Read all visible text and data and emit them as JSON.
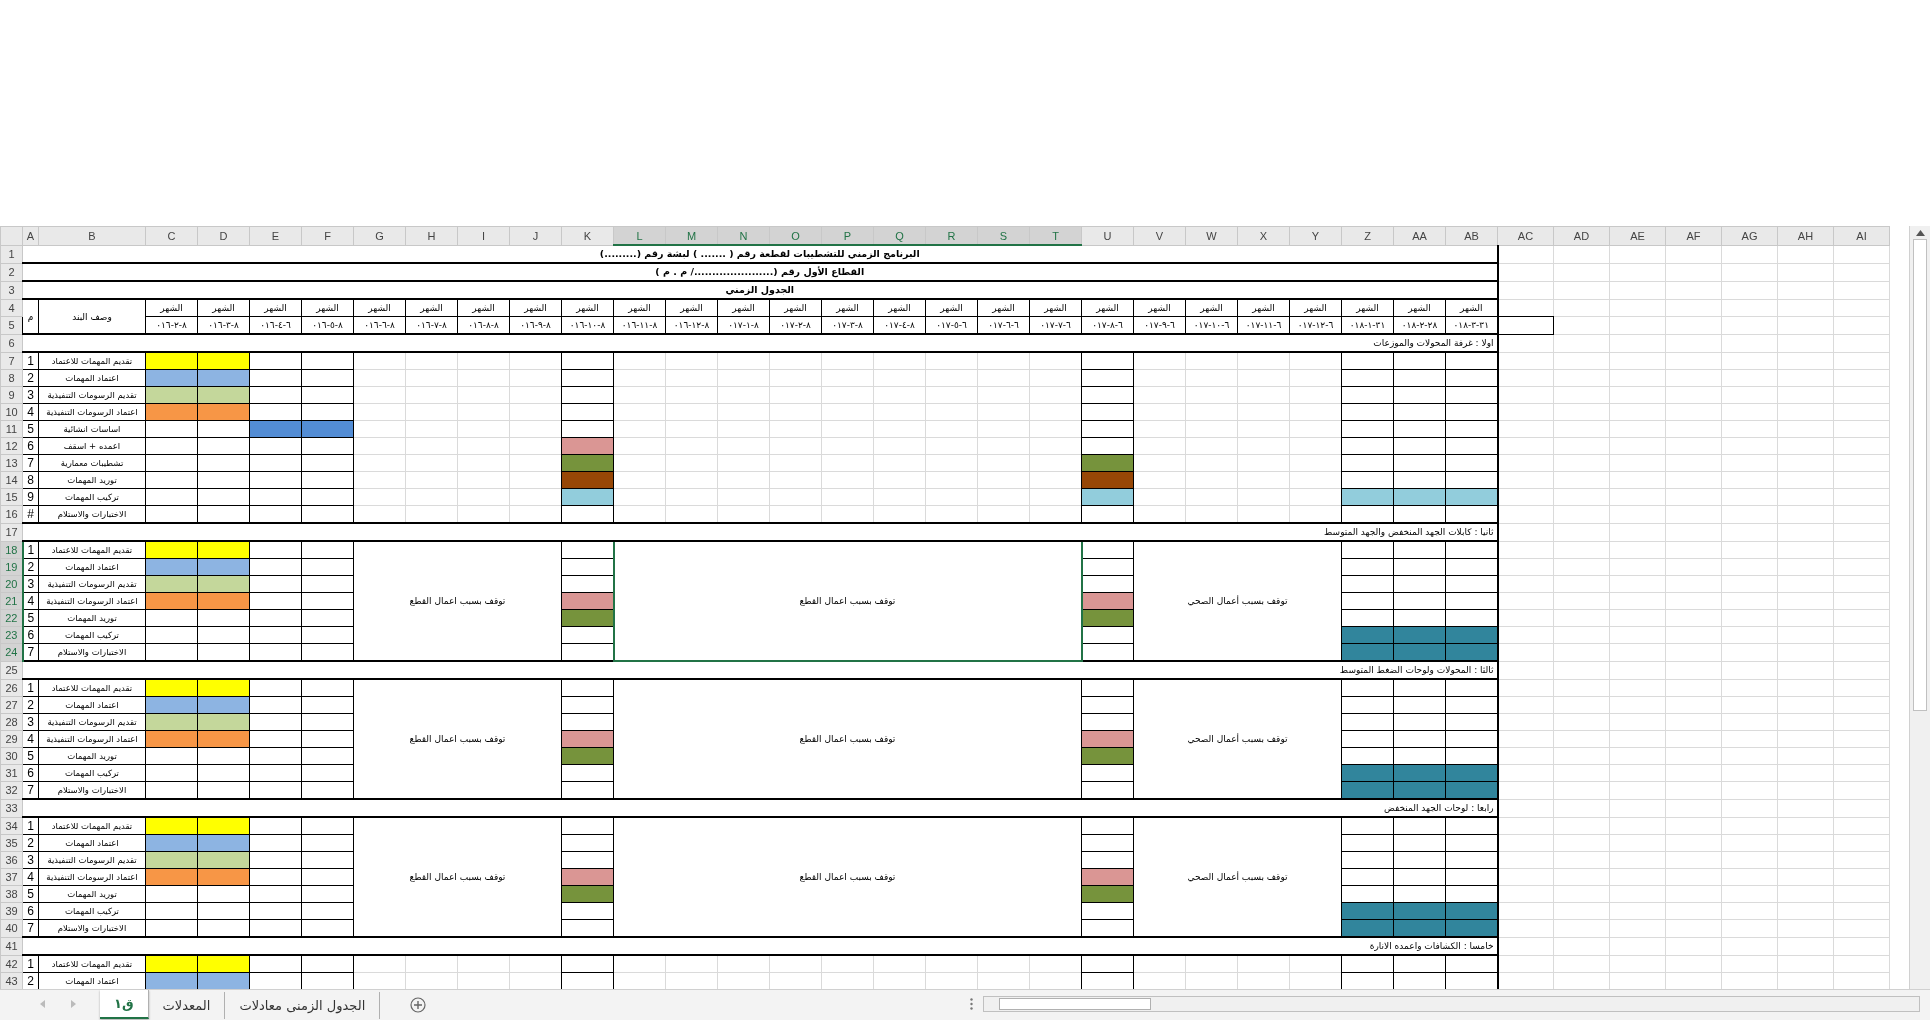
{
  "columns": [
    {
      "letter": "AI",
      "selected": false
    },
    {
      "letter": "AH",
      "selected": false
    },
    {
      "letter": "AG",
      "selected": false
    },
    {
      "letter": "AF",
      "selected": false
    },
    {
      "letter": "AE",
      "selected": false
    },
    {
      "letter": "AD",
      "selected": false
    },
    {
      "letter": "AC",
      "selected": false
    },
    {
      "letter": "AB",
      "selected": false
    },
    {
      "letter": "AA",
      "selected": false
    },
    {
      "letter": "Z",
      "selected": false
    },
    {
      "letter": "Y",
      "selected": false
    },
    {
      "letter": "X",
      "selected": false
    },
    {
      "letter": "W",
      "selected": false
    },
    {
      "letter": "V",
      "selected": false
    },
    {
      "letter": "U",
      "selected": false
    },
    {
      "letter": "T",
      "selected": true
    },
    {
      "letter": "S",
      "selected": true
    },
    {
      "letter": "R",
      "selected": true
    },
    {
      "letter": "Q",
      "selected": true
    },
    {
      "letter": "P",
      "selected": true
    },
    {
      "letter": "O",
      "selected": true
    },
    {
      "letter": "N",
      "selected": true
    },
    {
      "letter": "M",
      "selected": true
    },
    {
      "letter": "L",
      "selected": true
    },
    {
      "letter": "K",
      "selected": false
    },
    {
      "letter": "J",
      "selected": false
    },
    {
      "letter": "I",
      "selected": false
    },
    {
      "letter": "H",
      "selected": false
    },
    {
      "letter": "G",
      "selected": false
    },
    {
      "letter": "F",
      "selected": false
    },
    {
      "letter": "E",
      "selected": false
    },
    {
      "letter": "D",
      "selected": false
    },
    {
      "letter": "C",
      "selected": false
    },
    {
      "letter": "B",
      "selected": false
    },
    {
      "letter": "A",
      "selected": false
    }
  ],
  "row_headers": [
    {
      "number": "1",
      "selected": false
    },
    {
      "number": "2",
      "selected": false
    },
    {
      "number": "3",
      "selected": false
    },
    {
      "number": "4",
      "selected": false
    },
    {
      "number": "5",
      "selected": false
    },
    {
      "number": "6",
      "selected": false
    },
    {
      "number": "7",
      "selected": false
    },
    {
      "number": "8",
      "selected": false
    },
    {
      "number": "9",
      "selected": false
    },
    {
      "number": "10",
      "selected": false
    },
    {
      "number": "11",
      "selected": false
    },
    {
      "number": "12",
      "selected": false
    },
    {
      "number": "13",
      "selected": false
    },
    {
      "number": "14",
      "selected": false
    },
    {
      "number": "15",
      "selected": false
    },
    {
      "number": "16",
      "selected": false
    },
    {
      "number": "17",
      "selected": false
    },
    {
      "number": "18",
      "selected": true
    },
    {
      "number": "19",
      "selected": true
    },
    {
      "number": "20",
      "selected": true
    },
    {
      "number": "21",
      "selected": true
    },
    {
      "number": "22",
      "selected": true
    },
    {
      "number": "23",
      "selected": true
    },
    {
      "number": "24",
      "selected": true
    },
    {
      "number": "25",
      "selected": false
    },
    {
      "number": "26",
      "selected": false
    },
    {
      "number": "27",
      "selected": false
    },
    {
      "number": "28",
      "selected": false
    },
    {
      "number": "29",
      "selected": false
    },
    {
      "number": "30",
      "selected": false
    },
    {
      "number": "31",
      "selected": false
    },
    {
      "number": "32",
      "selected": false
    },
    {
      "number": "33",
      "selected": false
    },
    {
      "number": "34",
      "selected": false
    },
    {
      "number": "35",
      "selected": false
    },
    {
      "number": "36",
      "selected": false
    },
    {
      "number": "37",
      "selected": false
    },
    {
      "number": "38",
      "selected": false
    },
    {
      "number": "39",
      "selected": false
    },
    {
      "number": "40",
      "selected": false
    },
    {
      "number": "41",
      "selected": false
    },
    {
      "number": "42",
      "selected": false
    },
    {
      "number": "43",
      "selected": false
    }
  ],
  "titles": [
    "البرنامج الزمني للتشطيبات لقطعة رقم ( ....... ) لبشة رقم (.........)",
    "القطاع الأول رقم (....................../ م . م )",
    "الجدول الزمني"
  ],
  "header": {
    "number_label": "م",
    "description_label": "وصف البند",
    "months": [
      {
        "label": "الشهر",
        "date": "٠١٨-٣-٣١"
      },
      {
        "label": "الشهر",
        "date": "٠١٨-٢-٢٨"
      },
      {
        "label": "الشهر",
        "date": "٠١٨-١-٣١"
      },
      {
        "label": "الشهر",
        "date": "٠١٧-١٢-٦"
      },
      {
        "label": "الشهر",
        "date": "٠١٧-١١-٦"
      },
      {
        "label": "الشهر",
        "date": "٠١٧-١٠-٦"
      },
      {
        "label": "الشهر",
        "date": "٠١٧-٩-٦"
      },
      {
        "label": "الشهر",
        "date": "٠١٧-٨-٦"
      },
      {
        "label": "الشهر",
        "date": "٠١٧-٧-٦"
      },
      {
        "label": "الشهر",
        "date": "٠١٧-٦-٦"
      },
      {
        "label": "الشهر",
        "date": "٠١٧-٥-٦"
      },
      {
        "label": "الشهر",
        "date": "٠١٧-٤-٨"
      },
      {
        "label": "الشهر",
        "date": "٠١٧-٣-٨"
      },
      {
        "label": "الشهر",
        "date": "٠١٧-٢-٨"
      },
      {
        "label": "الشهر",
        "date": "٠١٧-١-٨"
      },
      {
        "label": "الشهر",
        "date": "٠١٦-١٢-٨"
      },
      {
        "label": "الشهر",
        "date": "٠١٦-١١-٨"
      },
      {
        "label": "الشهر",
        "date": "٠١٦-١٠-٨"
      },
      {
        "label": "الشهر",
        "date": "٠١٦-٩-٨"
      },
      {
        "label": "الشهر",
        "date": "٠١٦-٨-٨"
      },
      {
        "label": "الشهر",
        "date": "٠١٦-٧-٨"
      },
      {
        "label": "الشهر",
        "date": "٠١٦-٦-٨"
      },
      {
        "label": "الشهر",
        "date": "٠١٦-٥-٨"
      },
      {
        "label": "الشهر",
        "date": "٠١٦-٤-٦"
      },
      {
        "label": "الشهر",
        "date": "٠١٦-٣-٨"
      },
      {
        "label": "الشهر",
        "date": "٠١٦-٢-٨"
      }
    ]
  },
  "sections": [
    {
      "title": "اولا : غرفة المحولات والموزعات",
      "items": [
        {
          "number": "1",
          "description": "تقديم المهمات للاعتماد",
          "cells": [
            {
              "kind": "blank"
            },
            {
              "kind": "blank"
            },
            {
              "kind": "blank"
            },
            {
              "kind": "blank"
            },
            {
              "kind": "blank"
            },
            {
              "kind": "blank"
            },
            {
              "kind": "blank"
            },
            {
              "kind": "bar",
              "color": "#ffff00"
            },
            {
              "kind": "bar",
              "color": "#ffff00"
            }
          ]
        },
        {
          "number": "2",
          "description": "اعتماد المهمات",
          "cells": [
            {
              "kind": "blank"
            },
            {
              "kind": "blank"
            },
            {
              "kind": "blank"
            },
            {
              "kind": "blank"
            },
            {
              "kind": "blank"
            },
            {
              "kind": "blank"
            },
            {
              "kind": "blank"
            },
            {
              "kind": "bar",
              "color": "#8db4e2"
            },
            {
              "kind": "bar",
              "color": "#8db4e2"
            }
          ]
        },
        {
          "number": "3",
          "description": "تقديم الرسومات التنفيذية",
          "cells": [
            {
              "kind": "blank"
            },
            {
              "kind": "blank"
            },
            {
              "kind": "blank"
            },
            {
              "kind": "blank"
            },
            {
              "kind": "blank"
            },
            {
              "kind": "blank"
            },
            {
              "kind": "blank"
            },
            {
              "kind": "bar",
              "color": "#c4d79b"
            },
            {
              "kind": "bar",
              "color": "#c4d79b"
            }
          ]
        },
        {
          "number": "4",
          "description": "اعتماد الرسومات التنفيذية",
          "cells": [
            {
              "kind": "blank"
            },
            {
              "kind": "blank"
            },
            {
              "kind": "blank"
            },
            {
              "kind": "blank"
            },
            {
              "kind": "blank"
            },
            {
              "kind": "blank"
            },
            {
              "kind": "blank"
            },
            {
              "kind": "bar",
              "color": "#f79646"
            },
            {
              "kind": "bar",
              "color": "#f79646"
            }
          ]
        },
        {
          "number": "5",
          "description": "اساسات انشائية",
          "cells": [
            {
              "kind": "blank"
            },
            {
              "kind": "blank"
            },
            {
              "kind": "blank"
            },
            {
              "kind": "blank"
            },
            {
              "kind": "blank"
            },
            {
              "kind": "bar",
              "color": "#538dd5"
            },
            {
              "kind": "bar",
              "color": "#538dd5"
            },
            {
              "kind": "blank"
            },
            {
              "kind": "blank"
            }
          ]
        },
        {
          "number": "6",
          "description": "اعمده + اسقف",
          "cells": [
            {
              "kind": "blank"
            },
            {
              "kind": "blank"
            },
            {
              "kind": "blank"
            },
            {
              "kind": "blank"
            },
            {
              "kind": "bar",
              "color": "#da9694"
            },
            {
              "kind": "blank"
            },
            {
              "kind": "blank"
            },
            {
              "kind": "blank"
            },
            {
              "kind": "blank"
            }
          ]
        },
        {
          "number": "7",
          "description": "تشطيبات معمارية",
          "cells": [
            {
              "kind": "blank"
            },
            {
              "kind": "blank"
            },
            {
              "kind": "blank"
            },
            {
              "kind": "bar",
              "color": "#76933c"
            },
            {
              "kind": "bar",
              "color": "#76933c"
            },
            {
              "kind": "blank"
            },
            {
              "kind": "blank"
            },
            {
              "kind": "blank"
            },
            {
              "kind": "blank"
            }
          ]
        },
        {
          "number": "8",
          "description": "توريد المهمات",
          "cells": [
            {
              "kind": "blank"
            },
            {
              "kind": "blank"
            },
            {
              "kind": "blank"
            },
            {
              "kind": "bar",
              "color": "#974706"
            },
            {
              "kind": "bar",
              "color": "#974706"
            },
            {
              "kind": "blank"
            },
            {
              "kind": "blank"
            },
            {
              "kind": "blank"
            },
            {
              "kind": "blank"
            }
          ]
        },
        {
          "number": "9",
          "description": "تركيب المهمات",
          "cells": [
            {
              "kind": "bar",
              "color": "#92cddc"
            },
            {
              "kind": "bar",
              "color": "#92cddc"
            },
            {
              "kind": "bar",
              "color": "#92cddc"
            },
            {
              "kind": "bar",
              "color": "#92cddc"
            },
            {
              "kind": "bar",
              "color": "#92cddc"
            },
            {
              "kind": "blank"
            },
            {
              "kind": "blank"
            },
            {
              "kind": "blank"
            },
            {
              "kind": "blank"
            }
          ]
        },
        {
          "number": "#",
          "description": "الاختبارات والاستلام",
          "cells": [
            {
              "kind": "blank"
            },
            {
              "kind": "blank"
            },
            {
              "kind": "blank"
            },
            {
              "kind": "blank"
            },
            {
              "kind": "blank"
            },
            {
              "kind": "blank"
            },
            {
              "kind": "blank"
            },
            {
              "kind": "blank"
            },
            {
              "kind": "blank"
            }
          ]
        }
      ]
    },
    {
      "title": "ثانيا : كابلات الجهد المنخفض والجهد المتوسط",
      "notes": [
        {
          "text": "توقف بسبب أعمال الصحي",
          "selected": false
        },
        {
          "text": "توقف بسبب اعمال القطع",
          "selected": true
        },
        {
          "text": "توقف بسبب اعمال القطع",
          "selected": false
        }
      ],
      "items": [
        {
          "number": "1",
          "description": "تقديم المهمات للاعتماد",
          "cells": [
            {
              "kind": "blank"
            },
            {
              "kind": "blank"
            },
            {
              "kind": "blank"
            },
            {
              "kind": "blank"
            },
            {
              "kind": "blank"
            },
            {
              "kind": "blank"
            },
            {
              "kind": "blank"
            },
            {
              "kind": "bar",
              "color": "#ffff00"
            },
            {
              "kind": "bar",
              "color": "#ffff00"
            }
          ]
        },
        {
          "number": "2",
          "description": "اعتماد المهمات",
          "cells": [
            {
              "kind": "blank"
            },
            {
              "kind": "blank"
            },
            {
              "kind": "blank"
            },
            {
              "kind": "blank"
            },
            {
              "kind": "blank"
            },
            {
              "kind": "blank"
            },
            {
              "kind": "blank"
            },
            {
              "kind": "bar",
              "color": "#8db4e2"
            },
            {
              "kind": "bar",
              "color": "#8db4e2"
            }
          ]
        },
        {
          "number": "3",
          "description": "تقديم الرسومات التنفيذية",
          "cells": [
            {
              "kind": "blank"
            },
            {
              "kind": "blank"
            },
            {
              "kind": "blank"
            },
            {
              "kind": "blank"
            },
            {
              "kind": "blank"
            },
            {
              "kind": "blank"
            },
            {
              "kind": "blank"
            },
            {
              "kind": "bar",
              "color": "#c4d79b"
            },
            {
              "kind": "bar",
              "color": "#c4d79b"
            }
          ]
        },
        {
          "number": "4",
          "description": "اعتماد الرسومات التنفيذية",
          "cells": [
            {
              "kind": "blank"
            },
            {
              "kind": "blank"
            },
            {
              "kind": "blank"
            },
            {
              "kind": "bar",
              "color": "#da9694"
            },
            {
              "kind": "bar",
              "color": "#da9694"
            },
            {
              "kind": "blank"
            },
            {
              "kind": "blank"
            },
            {
              "kind": "bar",
              "color": "#f79646"
            },
            {
              "kind": "bar",
              "color": "#f79646"
            }
          ]
        },
        {
          "number": "5",
          "description": "توريد المهمات",
          "cells": [
            {
              "kind": "blank"
            },
            {
              "kind": "blank"
            },
            {
              "kind": "blank"
            },
            {
              "kind": "bar",
              "color": "#76933c"
            },
            {
              "kind": "bar",
              "color": "#76933c"
            },
            {
              "kind": "blank"
            },
            {
              "kind": "blank"
            },
            {
              "kind": "blank"
            },
            {
              "kind": "blank"
            }
          ]
        },
        {
          "number": "6",
          "description": "تركيب المهمات",
          "cells": [
            {
              "kind": "bar",
              "color": "#31859c"
            },
            {
              "kind": "bar",
              "color": "#31859c"
            },
            {
              "kind": "bar",
              "color": "#31859c"
            },
            {
              "kind": "blank"
            },
            {
              "kind": "blank"
            },
            {
              "kind": "blank"
            },
            {
              "kind": "blank"
            },
            {
              "kind": "blank"
            },
            {
              "kind": "blank"
            }
          ]
        },
        {
          "number": "7",
          "description": "الاختبارات والاستلام",
          "cells": [
            {
              "kind": "bar",
              "color": "#31859c"
            },
            {
              "kind": "bar",
              "color": "#31859c"
            },
            {
              "kind": "bar",
              "color": "#31859c"
            },
            {
              "kind": "blank"
            },
            {
              "kind": "blank"
            },
            {
              "kind": "blank"
            },
            {
              "kind": "blank"
            },
            {
              "kind": "blank"
            },
            {
              "kind": "blank"
            }
          ]
        }
      ]
    },
    {
      "title": "ثالثا : المحولات ولوحات الضغط المتوسط",
      "notes": [
        {
          "text": "توقف بسبب أعمال الصحي",
          "selected": false
        },
        {
          "text": "توقف بسبب اعمال القطع",
          "selected": false
        },
        {
          "text": "توقف بسبب اعمال القطع",
          "selected": false
        }
      ],
      "items": [
        {
          "number": "1",
          "description": "تقديم المهمات للاعتماد",
          "cells": [
            {
              "kind": "blank"
            },
            {
              "kind": "blank"
            },
            {
              "kind": "blank"
            },
            {
              "kind": "blank"
            },
            {
              "kind": "blank"
            },
            {
              "kind": "blank"
            },
            {
              "kind": "blank"
            },
            {
              "kind": "bar",
              "color": "#ffff00"
            },
            {
              "kind": "bar",
              "color": "#ffff00"
            }
          ]
        },
        {
          "number": "2",
          "description": "اعتماد المهمات",
          "cells": [
            {
              "kind": "blank"
            },
            {
              "kind": "blank"
            },
            {
              "kind": "blank"
            },
            {
              "kind": "blank"
            },
            {
              "kind": "blank"
            },
            {
              "kind": "blank"
            },
            {
              "kind": "blank"
            },
            {
              "kind": "bar",
              "color": "#8db4e2"
            },
            {
              "kind": "bar",
              "color": "#8db4e2"
            }
          ]
        },
        {
          "number": "3",
          "description": "تقديم الرسومات التنفيذية",
          "cells": [
            {
              "kind": "blank"
            },
            {
              "kind": "blank"
            },
            {
              "kind": "blank"
            },
            {
              "kind": "blank"
            },
            {
              "kind": "blank"
            },
            {
              "kind": "blank"
            },
            {
              "kind": "blank"
            },
            {
              "kind": "bar",
              "color": "#c4d79b"
            },
            {
              "kind": "bar",
              "color": "#c4d79b"
            }
          ]
        },
        {
          "number": "4",
          "description": "اعتماد الرسومات التنفيذية",
          "cells": [
            {
              "kind": "blank"
            },
            {
              "kind": "blank"
            },
            {
              "kind": "blank"
            },
            {
              "kind": "bar",
              "color": "#da9694"
            },
            {
              "kind": "bar",
              "color": "#da9694"
            },
            {
              "kind": "blank"
            },
            {
              "kind": "blank"
            },
            {
              "kind": "bar",
              "color": "#f79646"
            },
            {
              "kind": "bar",
              "color": "#f79646"
            }
          ]
        },
        {
          "number": "5",
          "description": "توريد المهمات",
          "cells": [
            {
              "kind": "blank"
            },
            {
              "kind": "blank"
            },
            {
              "kind": "blank"
            },
            {
              "kind": "bar",
              "color": "#76933c"
            },
            {
              "kind": "bar",
              "color": "#76933c"
            },
            {
              "kind": "blank"
            },
            {
              "kind": "blank"
            },
            {
              "kind": "blank"
            },
            {
              "kind": "blank"
            }
          ]
        },
        {
          "number": "6",
          "description": "تركيب المهمات",
          "cells": [
            {
              "kind": "bar",
              "color": "#31859c"
            },
            {
              "kind": "bar",
              "color": "#31859c"
            },
            {
              "kind": "bar",
              "color": "#31859c"
            },
            {
              "kind": "blank"
            },
            {
              "kind": "blank"
            },
            {
              "kind": "blank"
            },
            {
              "kind": "blank"
            },
            {
              "kind": "blank"
            },
            {
              "kind": "blank"
            }
          ]
        },
        {
          "number": "7",
          "description": "الاختبارات والاستلام",
          "cells": [
            {
              "kind": "bar",
              "color": "#31859c"
            },
            {
              "kind": "bar",
              "color": "#31859c"
            },
            {
              "kind": "bar",
              "color": "#31859c"
            },
            {
              "kind": "blank"
            },
            {
              "kind": "blank"
            },
            {
              "kind": "blank"
            },
            {
              "kind": "blank"
            },
            {
              "kind": "blank"
            },
            {
              "kind": "blank"
            }
          ]
        }
      ]
    },
    {
      "title": "رابعا : لوحات الجهد المنخفض",
      "notes": [
        {
          "text": "توقف بسبب أعمال الصحي",
          "selected": false
        },
        {
          "text": "توقف بسبب اعمال القطع",
          "selected": false
        },
        {
          "text": "توقف بسبب اعمال القطع",
          "selected": false
        }
      ],
      "items": [
        {
          "number": "1",
          "description": "تقديم المهمات للاعتماد",
          "cells": [
            {
              "kind": "blank"
            },
            {
              "kind": "blank"
            },
            {
              "kind": "blank"
            },
            {
              "kind": "blank"
            },
            {
              "kind": "blank"
            },
            {
              "kind": "blank"
            },
            {
              "kind": "blank"
            },
            {
              "kind": "bar",
              "color": "#ffff00"
            },
            {
              "kind": "bar",
              "color": "#ffff00"
            }
          ]
        },
        {
          "number": "2",
          "description": "اعتماد المهمات",
          "cells": [
            {
              "kind": "blank"
            },
            {
              "kind": "blank"
            },
            {
              "kind": "blank"
            },
            {
              "kind": "blank"
            },
            {
              "kind": "blank"
            },
            {
              "kind": "blank"
            },
            {
              "kind": "blank"
            },
            {
              "kind": "bar",
              "color": "#8db4e2"
            },
            {
              "kind": "bar",
              "color": "#8db4e2"
            }
          ]
        },
        {
          "number": "3",
          "description": "تقديم الرسومات التنفيذية",
          "cells": [
            {
              "kind": "blank"
            },
            {
              "kind": "blank"
            },
            {
              "kind": "blank"
            },
            {
              "kind": "blank"
            },
            {
              "kind": "blank"
            },
            {
              "kind": "blank"
            },
            {
              "kind": "blank"
            },
            {
              "kind": "bar",
              "color": "#c4d79b"
            },
            {
              "kind": "bar",
              "color": "#c4d79b"
            }
          ]
        },
        {
          "number": "4",
          "description": "اعتماد الرسومات التنفيذية",
          "cells": [
            {
              "kind": "blank"
            },
            {
              "kind": "blank"
            },
            {
              "kind": "blank"
            },
            {
              "kind": "bar",
              "color": "#da9694"
            },
            {
              "kind": "bar",
              "color": "#da9694"
            },
            {
              "kind": "blank"
            },
            {
              "kind": "blank"
            },
            {
              "kind": "bar",
              "color": "#f79646"
            },
            {
              "kind": "bar",
              "color": "#f79646"
            }
          ]
        },
        {
          "number": "5",
          "description": "توريد المهمات",
          "cells": [
            {
              "kind": "blank"
            },
            {
              "kind": "blank"
            },
            {
              "kind": "blank"
            },
            {
              "kind": "bar",
              "color": "#76933c"
            },
            {
              "kind": "bar",
              "color": "#76933c"
            },
            {
              "kind": "blank"
            },
            {
              "kind": "blank"
            },
            {
              "kind": "blank"
            },
            {
              "kind": "blank"
            }
          ]
        },
        {
          "number": "6",
          "description": "تركيب المهمات",
          "cells": [
            {
              "kind": "bar",
              "color": "#31859c"
            },
            {
              "kind": "bar",
              "color": "#31859c"
            },
            {
              "kind": "bar",
              "color": "#31859c"
            },
            {
              "kind": "blank"
            },
            {
              "kind": "blank"
            },
            {
              "kind": "blank"
            },
            {
              "kind": "blank"
            },
            {
              "kind": "blank"
            },
            {
              "kind": "blank"
            }
          ]
        },
        {
          "number": "7",
          "description": "الاختبارات والاستلام",
          "cells": [
            {
              "kind": "bar",
              "color": "#31859c"
            },
            {
              "kind": "bar",
              "color": "#31859c"
            },
            {
              "kind": "bar",
              "color": "#31859c"
            },
            {
              "kind": "blank"
            },
            {
              "kind": "blank"
            },
            {
              "kind": "blank"
            },
            {
              "kind": "blank"
            },
            {
              "kind": "blank"
            },
            {
              "kind": "blank"
            }
          ]
        }
      ]
    },
    {
      "title": "خامسا : الكشافات واعمده الانارة",
      "items": [
        {
          "number": "1",
          "description": "تقديم المهمات للاعتماد",
          "cells": [
            {
              "kind": "blank"
            },
            {
              "kind": "blank"
            },
            {
              "kind": "blank"
            },
            {
              "kind": "blank"
            },
            {
              "kind": "blank"
            },
            {
              "kind": "blank"
            },
            {
              "kind": "blank"
            },
            {
              "kind": "bar",
              "color": "#ffff00"
            },
            {
              "kind": "bar",
              "color": "#ffff00"
            }
          ]
        },
        {
          "number": "2",
          "description": "اعتماد المهمات",
          "cells": [
            {
              "kind": "blank"
            },
            {
              "kind": "blank"
            },
            {
              "kind": "blank"
            },
            {
              "kind": "blank"
            },
            {
              "kind": "blank"
            },
            {
              "kind": "blank"
            },
            {
              "kind": "blank"
            },
            {
              "kind": "bar",
              "color": "#8db4e2"
            },
            {
              "kind": "bar",
              "color": "#8db4e2"
            }
          ]
        }
      ]
    }
  ],
  "tabs": [
    {
      "label": "الجدول الزمنى معادلات",
      "selected": false
    },
    {
      "label": "المعدلات",
      "selected": false
    },
    {
      "label": "ق١",
      "selected": true
    }
  ]
}
